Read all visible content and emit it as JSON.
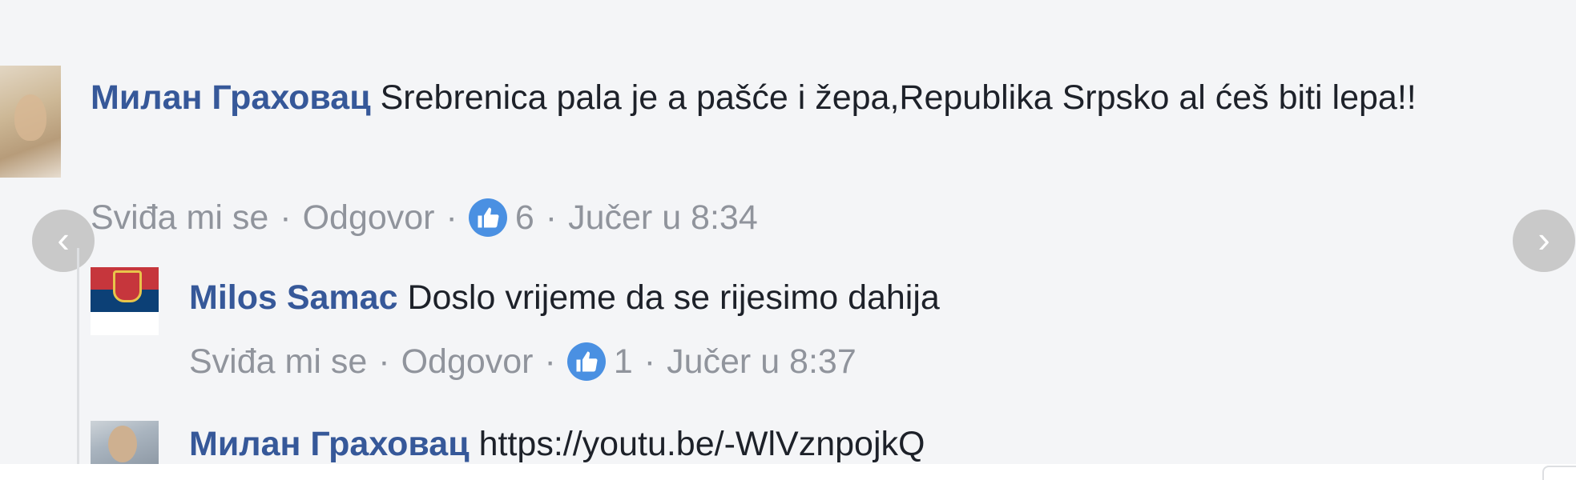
{
  "comments": [
    {
      "author": "Милан Граховац",
      "text": "Srebrenica pala je a pašće i žepa,Republika Srpsko al ćeš biti lepa!!",
      "like_label": "Sviđa mi se",
      "reply_label": "Odgovor",
      "reaction_count": "6",
      "timestamp": "Jučer u 8:34"
    }
  ],
  "replies": [
    {
      "author": "Milos Samac",
      "text": "Doslo vrijeme da se rijesimo dahija",
      "like_label": "Sviđa mi se",
      "reply_label": "Odgovor",
      "reaction_count": "1",
      "timestamp": "Jučer u 8:37"
    },
    {
      "author": "Милан Граховац",
      "text": "https://youtu.be/-WlVznpojkQ"
    }
  ],
  "separator": "·",
  "icons": {
    "like": "thumbs-up-icon",
    "prev": "chevron-left-icon",
    "next": "chevron-right-icon"
  },
  "colors": {
    "author": "#365899",
    "meta": "#90949c",
    "like_badge": "#4a90e2",
    "background": "#f4f5f7"
  }
}
